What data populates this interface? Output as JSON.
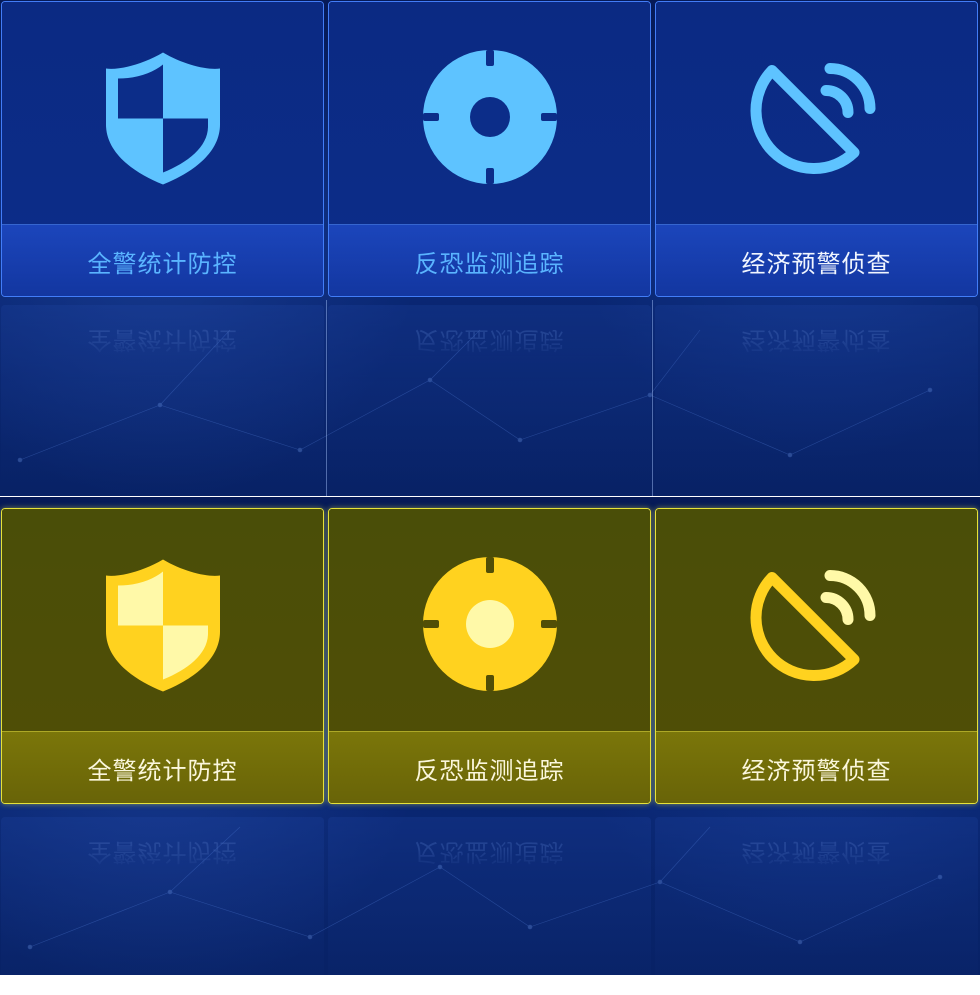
{
  "states": [
    {
      "state": "default",
      "colors": {
        "icon": "#5ec3ff",
        "icon_inner": "#0c2d89",
        "label": "#5ab4ff",
        "label_active": "#f1f6ff",
        "border": "#4682ff"
      },
      "tiles": [
        {
          "icon": "shield-icon",
          "label": "全警统计防控"
        },
        {
          "icon": "crosshair-icon",
          "label": "反恐监测追踪"
        },
        {
          "icon": "satellite-dish-icon",
          "label": "经济预警侦查"
        }
      ]
    },
    {
      "state": "highlighted",
      "colors": {
        "icon": "#ffd21f",
        "icon_inner": "#fff9a8",
        "label": "#fbf7dc",
        "border": "#e6e23a"
      },
      "tiles": [
        {
          "icon": "shield-icon",
          "label": "全警统计防控"
        },
        {
          "icon": "crosshair-icon",
          "label": "反恐监测追踪"
        },
        {
          "icon": "satellite-dish-icon",
          "label": "经济预警侦查"
        }
      ]
    }
  ]
}
